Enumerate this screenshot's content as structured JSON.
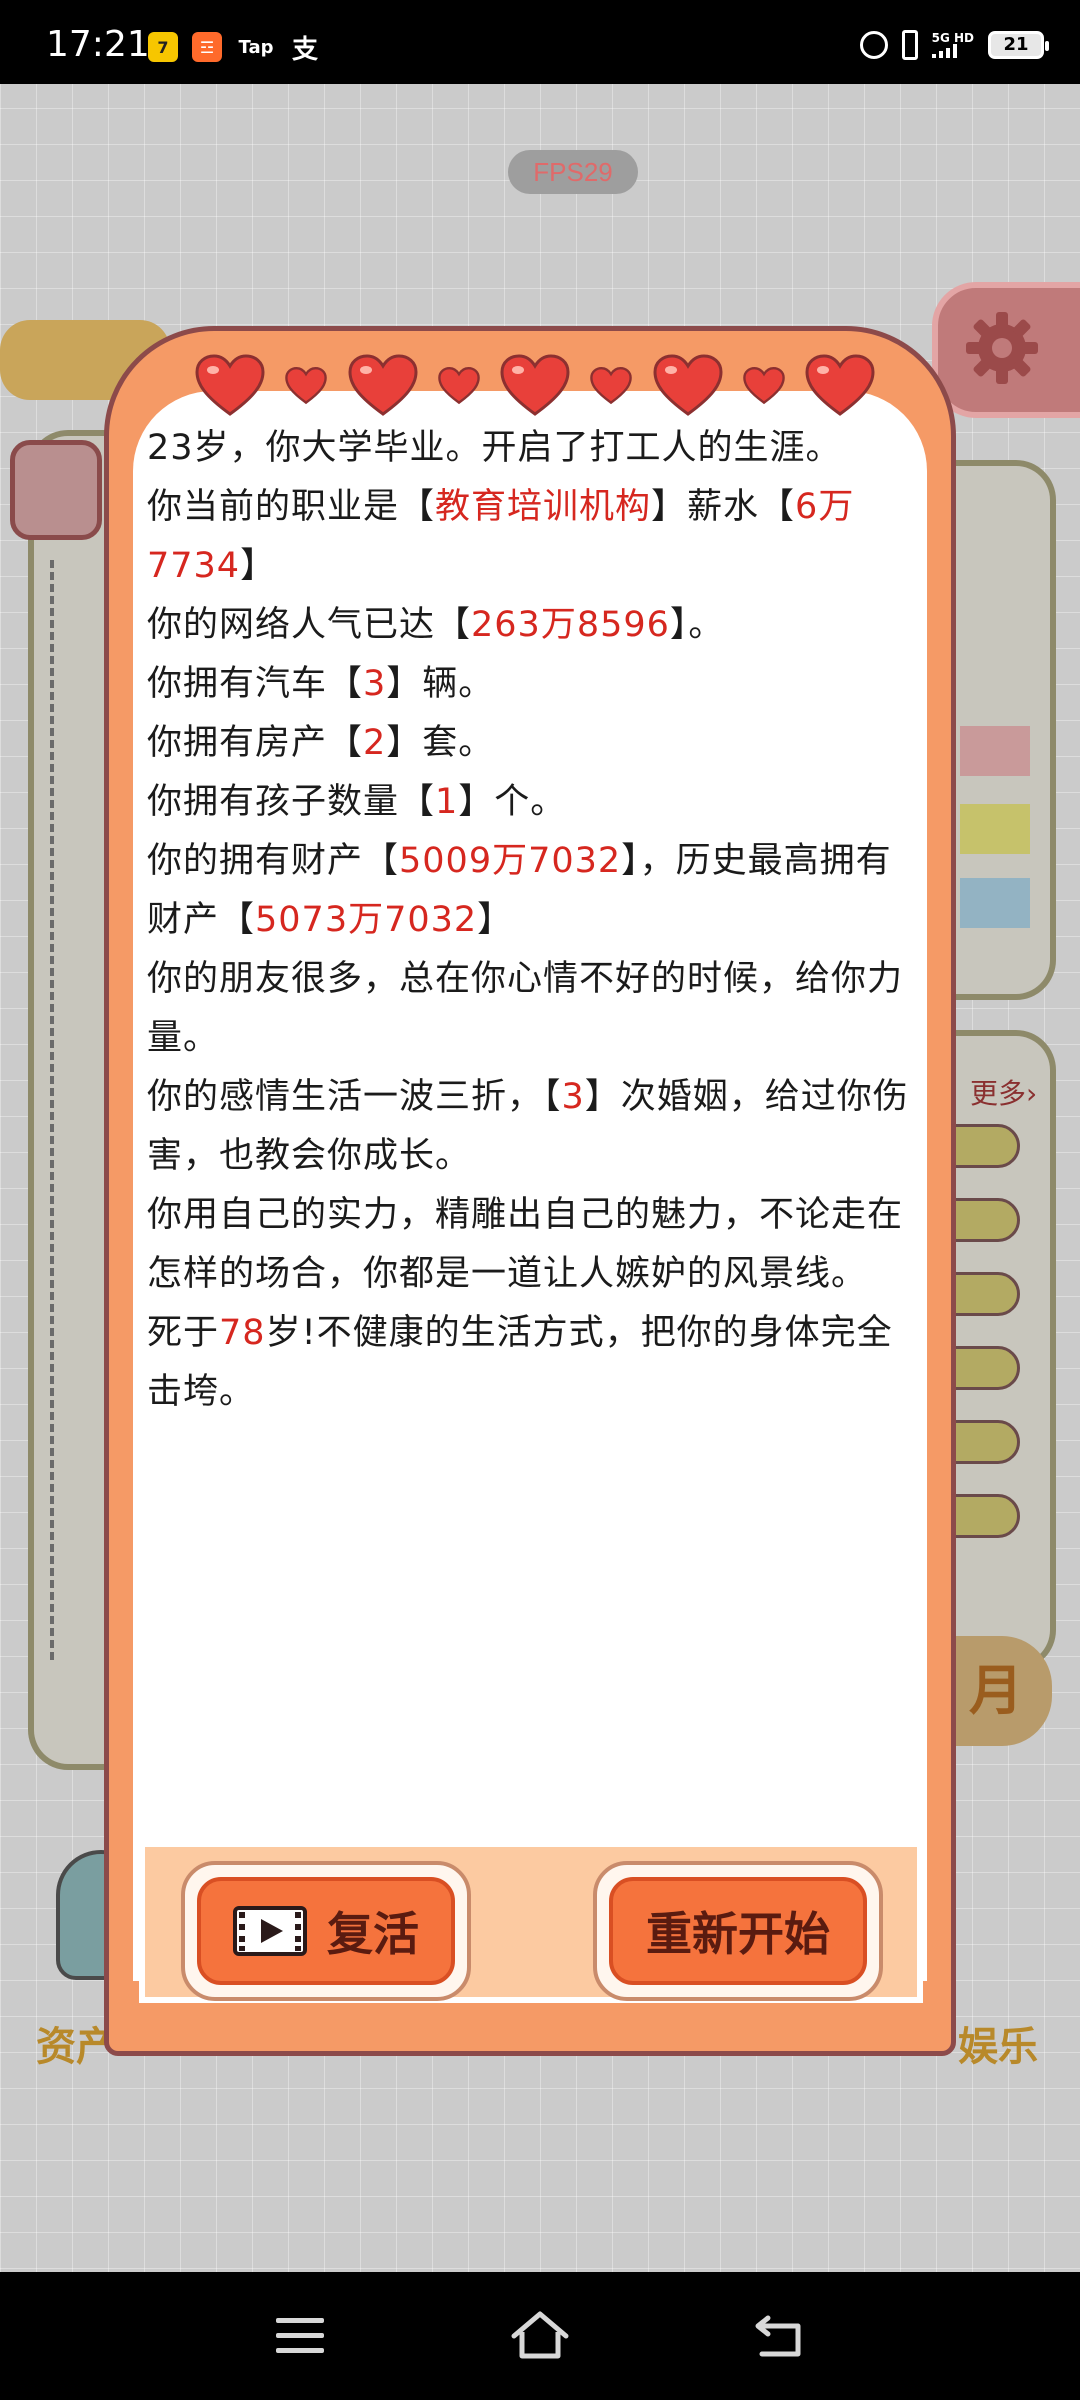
{
  "status_bar": {
    "time": "17:21",
    "app_icons": [
      "7",
      "☲",
      "Tap",
      "支"
    ],
    "network": "5G HD",
    "battery": "21"
  },
  "fps_label": "FPS29",
  "background": {
    "more_label": "更多›",
    "moon_label": "月",
    "bottom_labels": [
      "资产",
      "娱乐"
    ]
  },
  "dialog": {
    "lines": [
      [
        {
          "t": "23岁，你大学毕业。开启了打工人的生涯。"
        }
      ],
      [
        {
          "t": "你当前的职业是【"
        },
        {
          "t": "教育培训机构",
          "hl": true
        },
        {
          "t": "】薪水【"
        },
        {
          "t": "6万7734",
          "hl": true
        },
        {
          "t": "】"
        }
      ],
      [
        {
          "t": "你的网络人气已达【"
        },
        {
          "t": "263万8596",
          "hl": true
        },
        {
          "t": "】。"
        }
      ],
      [
        {
          "t": "你拥有汽车【"
        },
        {
          "t": "3",
          "hl": true
        },
        {
          "t": "】辆。"
        }
      ],
      [
        {
          "t": "你拥有房产【"
        },
        {
          "t": "2",
          "hl": true
        },
        {
          "t": "】套。"
        }
      ],
      [
        {
          "t": "你拥有孩子数量【"
        },
        {
          "t": "1",
          "hl": true
        },
        {
          "t": "】个。"
        }
      ],
      [
        {
          "t": "你的拥有财产【"
        },
        {
          "t": "5009万7032",
          "hl": true
        },
        {
          "t": "】，历史最高拥有财产【"
        },
        {
          "t": "5073万7032",
          "hl": true
        },
        {
          "t": "】"
        }
      ],
      [
        {
          "t": "你的朋友很多，总在你心情不好的时候，给你力量。"
        }
      ],
      [
        {
          "t": "你的感情生活一波三折，【"
        },
        {
          "t": "3",
          "hl": true
        },
        {
          "t": "】次婚姻，给过你伤害，也教会你成长。"
        }
      ],
      [
        {
          "t": "你用自己的实力，精雕出自己的魅力，不论走在怎样的场合，你都是一道让人嫉妒的风景线。"
        }
      ],
      [
        {
          "t": "死于"
        },
        {
          "t": "78",
          "hl": true
        },
        {
          "t": "岁!不健康的生活方式，把你的身体完全击垮。"
        }
      ]
    ],
    "revive_label": "复活",
    "restart_label": "重新开始"
  },
  "colors": {
    "dialog_bg": "#f59a66",
    "highlight": "#d6271f",
    "button": "#f5733d"
  }
}
